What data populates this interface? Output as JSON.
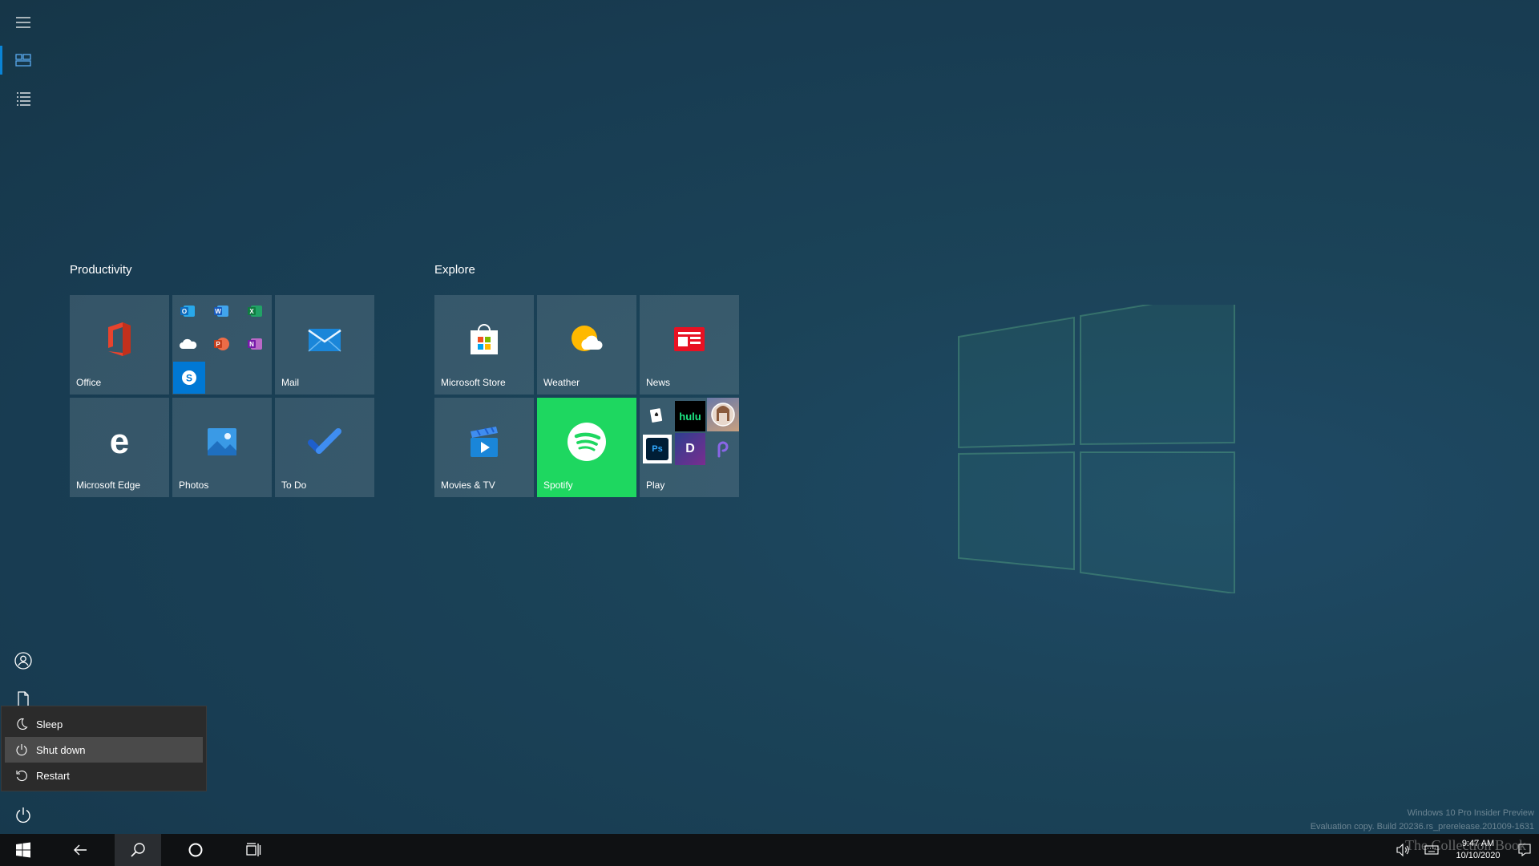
{
  "rail": {
    "items": [
      {
        "name": "menu-icon"
      },
      {
        "name": "pinned-tiles-icon"
      },
      {
        "name": "all-apps-list-icon"
      },
      {
        "name": "user-account-icon"
      },
      {
        "name": "documents-icon"
      },
      {
        "name": "power-icon"
      }
    ]
  },
  "groups": [
    {
      "title": "Productivity"
    },
    {
      "title": "Explore"
    }
  ],
  "tiles": {
    "office": "Office",
    "mail": "Mail",
    "edge": "Microsoft Edge",
    "photos": "Photos",
    "todo": "To Do",
    "store": "Microsoft Store",
    "weather": "Weather",
    "news": "News",
    "movies": "Movies & TV",
    "spotify": "Spotify",
    "play": "Play"
  },
  "play_folder": {
    "hulu": "hulu",
    "ps": "Ps",
    "dolby": "D"
  },
  "power_menu": {
    "items": [
      "Sleep",
      "Shut down",
      "Restart"
    ],
    "hovered": "Shut down"
  },
  "tray": {
    "time": "9:47 AM",
    "date": "10/10/2020"
  },
  "watermark": {
    "line1": "Windows 10 Pro Insider Preview",
    "line2": "Evaluation copy. Build 20236.rs_prerelease.201009-1631",
    "brand": "The Collection Book"
  },
  "colors": {
    "accent": "#0a84d6",
    "spotify": "#1ed760"
  }
}
